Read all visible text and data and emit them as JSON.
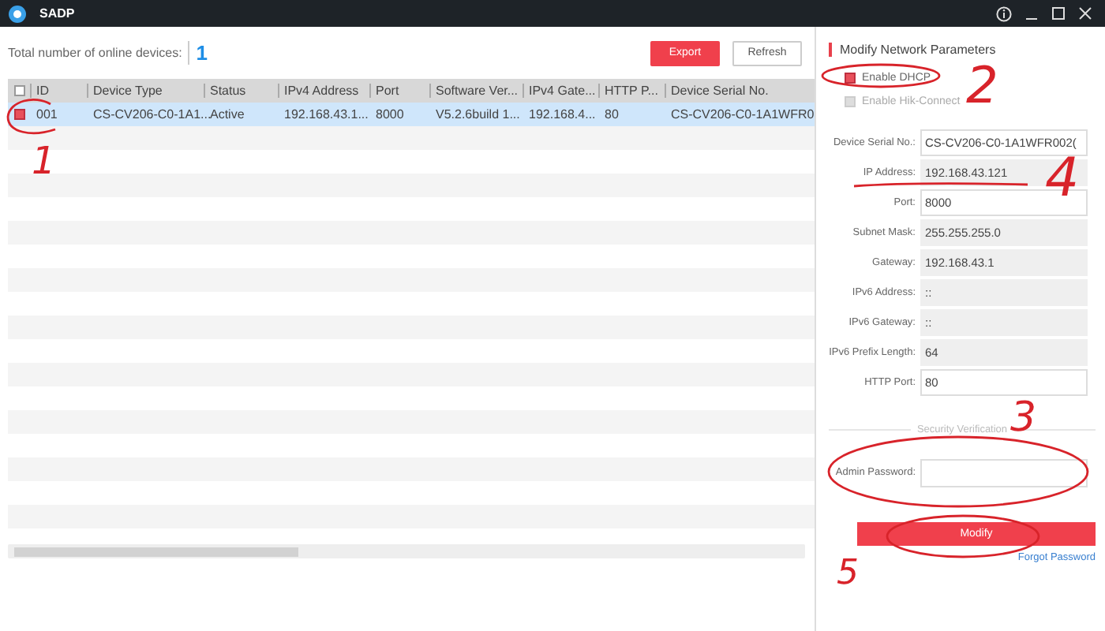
{
  "window": {
    "title": "SADP"
  },
  "summary": {
    "label": "Total number of online devices:",
    "count": "1"
  },
  "toolbar": {
    "buttons": [
      {
        "label": "Export",
        "kind": "primary"
      },
      {
        "label": "Refresh",
        "kind": "secondary"
      }
    ]
  },
  "table": {
    "header_checked": false,
    "columns": [
      "ID",
      "Device Type",
      "Status",
      "IPv4 Address",
      "Port",
      "Software Ver...",
      "IPv4 Gate...",
      "HTTP P...",
      "Device Serial No."
    ],
    "rows": [
      {
        "selected": true,
        "checked": true,
        "cells": [
          "001",
          "CS-CV206-C0-1A1...",
          "Active",
          "192.168.43.1...",
          "8000",
          "V5.2.6build 1...",
          "192.168.4...",
          "80",
          "CS-CV206-C0-1A1WFR0"
        ]
      }
    ]
  },
  "panel": {
    "title": "Modify Network Parameters",
    "options": [
      {
        "label": "Enable DHCP",
        "checked": true,
        "disabled": false
      },
      {
        "label": "Enable Hik-Connect",
        "checked": false,
        "disabled": true
      }
    ],
    "fields": [
      {
        "label": "Device Serial No.:",
        "value": "CS-CV206-C0-1A1WFR002(",
        "disabled": false
      },
      {
        "label": "IP Address:",
        "value": "192.168.43.121",
        "disabled": true
      },
      {
        "label": "Port:",
        "value": "8000",
        "disabled": false
      },
      {
        "label": "Subnet Mask:",
        "value": "255.255.255.0",
        "disabled": true
      },
      {
        "label": "Gateway:",
        "value": "192.168.43.1",
        "disabled": true
      },
      {
        "label": "IPv6 Address:",
        "value": "::",
        "disabled": true
      },
      {
        "label": "IPv6 Gateway:",
        "value": "::",
        "disabled": true
      },
      {
        "label": "IPv6 Prefix Length:",
        "value": "64",
        "disabled": true
      },
      {
        "label": "HTTP Port:",
        "value": "80",
        "disabled": false
      }
    ],
    "security_title": "Security Verification",
    "password": {
      "label": "Admin Password:"
    },
    "modify_button": "Modify",
    "forgot_link": "Forgot Password"
  },
  "annotations": [
    {
      "label": "1"
    },
    {
      "label": "2"
    },
    {
      "label": "3"
    },
    {
      "label": "4"
    },
    {
      "label": "5"
    }
  ]
}
